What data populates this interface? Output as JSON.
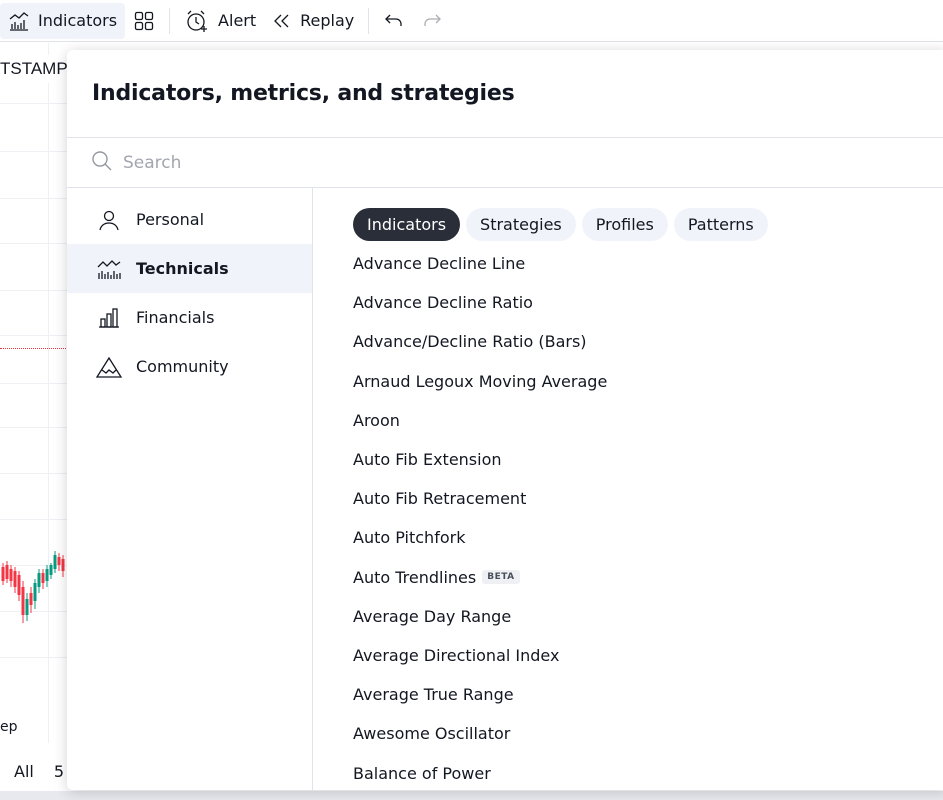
{
  "toolbar": {
    "indicators_label": "Indicators",
    "alert_label": "Alert",
    "replay_label": "Replay"
  },
  "chart": {
    "symbol_tag": "TSTAMP",
    "axis_date_fragment": "ep",
    "range_all": "All",
    "range_next_fragment": "5"
  },
  "dialog": {
    "title": "Indicators, metrics, and strategies",
    "search_placeholder": "Search",
    "sidebar": [
      {
        "label": "Personal",
        "icon": "person-icon"
      },
      {
        "label": "Technicals",
        "icon": "technicals-chart-icon",
        "active": true
      },
      {
        "label": "Financials",
        "icon": "bar-chart-icon"
      },
      {
        "label": "Community",
        "icon": "mountain-icon"
      }
    ],
    "tabs": [
      "Indicators",
      "Strategies",
      "Profiles",
      "Patterns"
    ],
    "active_tab": "Indicators",
    "items": [
      "Advance Decline Line",
      "Advance Decline Ratio",
      "Advance/Decline Ratio (Bars)",
      "Arnaud Legoux Moving Average",
      "Aroon",
      "Auto Fib Extension",
      "Auto Fib Retracement",
      "Auto Pitchfork",
      "Auto Trendlines",
      "Average Day Range",
      "Average Directional Index",
      "Average True Range",
      "Awesome Oscillator",
      "Balance of Power"
    ],
    "beta_badge": "BETA"
  },
  "colors": {
    "accent_dark": "#2a2e39",
    "tab_bg": "#f0f3fa",
    "candle_up": "#089981",
    "candle_down": "#f23645"
  }
}
